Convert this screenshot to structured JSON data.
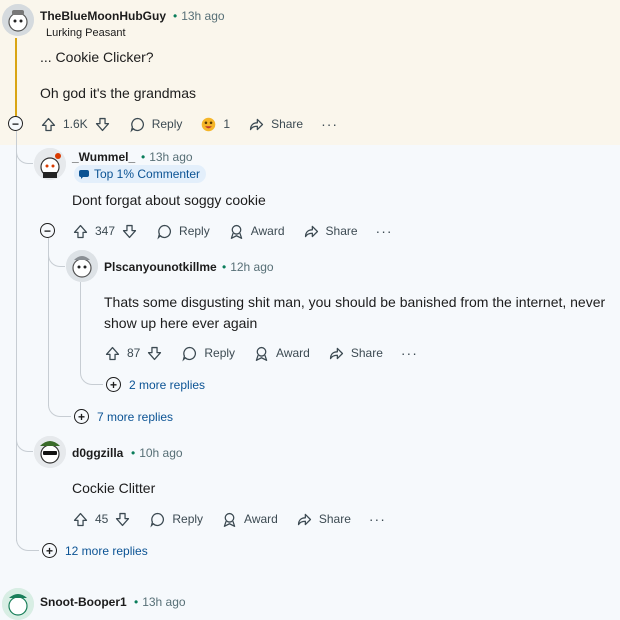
{
  "comments": [
    {
      "user": "TheBlueMoonHubGuy",
      "time": "13h ago",
      "flair": "Lurking Peasant",
      "lines": [
        "... Cookie Clicker?",
        "Oh god it's the grandmas"
      ],
      "votes": "1.6K",
      "reply": "Reply",
      "award_count": "1",
      "share": "Share",
      "more": "···"
    },
    {
      "user": "_Wummel_",
      "time": "13h ago",
      "badge": "Top 1% Commenter",
      "lines": [
        "Dont forgat about soggy cookie"
      ],
      "votes": "347",
      "reply": "Reply",
      "award": "Award",
      "share": "Share",
      "more": "···"
    },
    {
      "user": "Plscanyounotkillme",
      "time": "12h ago",
      "lines": [
        "Thats some disgusting shit man, you should be banished from the internet, never",
        "show up here ever again"
      ],
      "votes": "87",
      "reply": "Reply",
      "award": "Award",
      "share": "Share",
      "more": "···"
    },
    {
      "user": "d0ggzilla",
      "time": "10h ago",
      "lines": [
        "Cockie Clitter"
      ],
      "votes": "45",
      "reply": "Reply",
      "award": "Award",
      "share": "Share",
      "more": "···"
    },
    {
      "user": "Snoot-Booper1",
      "time": "13h ago"
    }
  ],
  "more_replies": [
    "2 more replies",
    "7 more replies",
    "12 more replies"
  ],
  "bullet": "•",
  "icons": {
    "upvote": "arrow-up-icon",
    "downvote": "arrow-down-icon",
    "reply": "speech-bubble-icon",
    "award": "award-icon",
    "share": "share-arrow-icon",
    "collapse": "minus-circle-icon",
    "expand": "plus-circle-icon"
  },
  "colors": {
    "highlight": "#faf6ec",
    "thread_gold": "#d9a514",
    "link": "#0b5394",
    "time_dot": "#0a7d5a"
  }
}
